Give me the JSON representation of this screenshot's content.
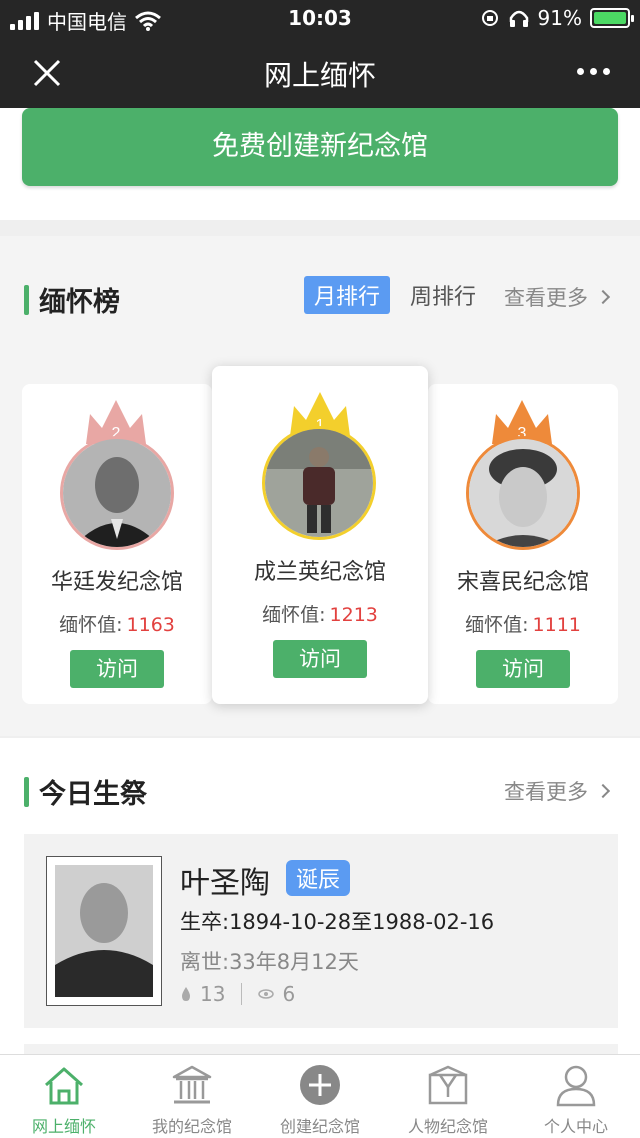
{
  "status_bar": {
    "carrier": "中国电信",
    "time": "10:03",
    "battery": "91%"
  },
  "nav": {
    "title": "网上缅怀"
  },
  "create_button": "免费创建新纪念馆",
  "ranking": {
    "title": "缅怀榜",
    "tabs": [
      "月排行",
      "周排行"
    ],
    "active_tab": "月排行",
    "more": "查看更多",
    "cards": [
      {
        "rank": "2",
        "name": "华廷发纪念馆",
        "value_label": "缅怀值:",
        "value": "1163",
        "visit": "访问",
        "crown_color": "#e8a7a4",
        "ring_color": "#e8a7a4"
      },
      {
        "rank": "1",
        "name": "成兰英纪念馆",
        "value_label": "缅怀值:",
        "value": "1213",
        "visit": "访问",
        "crown_color": "#f3cf2c",
        "ring_color": "#f3cf2c"
      },
      {
        "rank": "3",
        "name": "宋喜民纪念馆",
        "value_label": "缅怀值:",
        "value": "1111",
        "visit": "访问",
        "crown_color": "#ee8a3a",
        "ring_color": "#ee8a3a"
      }
    ]
  },
  "today": {
    "title": "今日生祭",
    "more": "查看更多",
    "person": {
      "name": "叶圣陶",
      "badge": "诞辰",
      "life": "生卒:1894-10-28至1988-02-16",
      "passed": "离世:33年8月12天",
      "flowers": "13",
      "views": "6"
    }
  },
  "tabbar": {
    "items": [
      {
        "label": "网上缅怀",
        "icon": "home-icon"
      },
      {
        "label": "我的纪念馆",
        "icon": "memorial-hall-icon"
      },
      {
        "label": "创建纪念馆",
        "icon": "add-circle-icon"
      },
      {
        "label": "人物纪念馆",
        "icon": "person-hall-icon"
      },
      {
        "label": "个人中心",
        "icon": "user-icon"
      }
    ],
    "active_index": 0
  },
  "colors": {
    "brand_green": "#4cb06a",
    "tab_blue": "#5b9bf2",
    "value_red": "#e2413f",
    "nav_dark": "#262626"
  }
}
